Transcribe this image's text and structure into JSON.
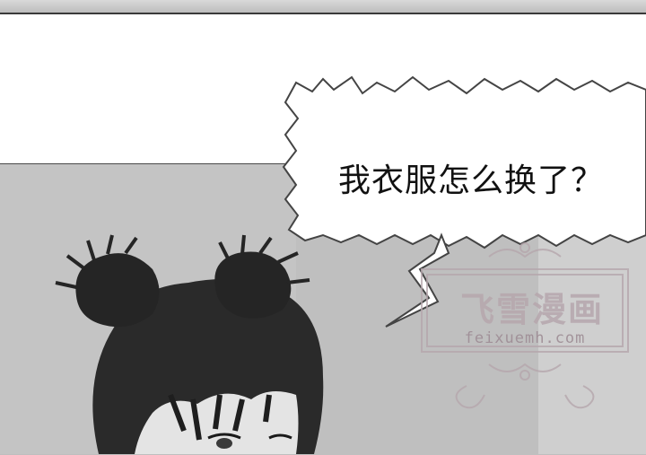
{
  "speech_bubble": {
    "text": "我衣服怎么换了？"
  },
  "watermark": {
    "title": "飞雪漫画",
    "url": "feixuemh.com",
    "color": "#b6a7ad"
  },
  "colors": {
    "panel_gray": "#bfbfbf",
    "border": "#3a3a3a",
    "hair": "#2a2a2a"
  }
}
